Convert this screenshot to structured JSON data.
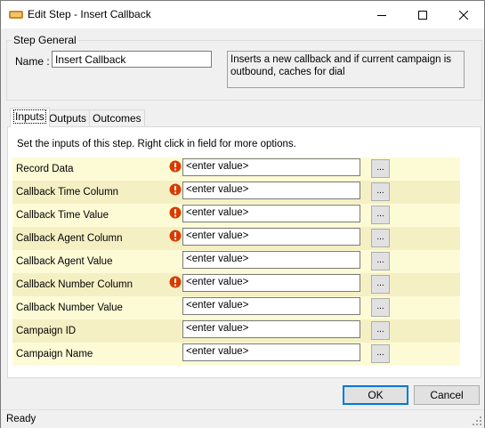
{
  "window": {
    "title": "Edit Step - Insert Callback",
    "controls": [
      "minimize",
      "maximize",
      "close"
    ]
  },
  "step_general": {
    "legend": "Step General",
    "name_label": "Name :",
    "name_value": "Insert Callback",
    "description": "Inserts a new callback and if current campaign is outbound, caches for dial"
  },
  "tabs": [
    {
      "label": "Inputs",
      "selected": true
    },
    {
      "label": "Outputs",
      "selected": false
    },
    {
      "label": "Outcomes",
      "selected": false
    }
  ],
  "inputs": {
    "instructions": "Set the inputs of this step.  Right click in field for more options.",
    "browse_label": "...",
    "rows": [
      {
        "label": "Record Data",
        "value": "<enter value>",
        "required": true
      },
      {
        "label": "Callback Time Column",
        "value": "<enter value>",
        "required": true
      },
      {
        "label": "Callback Time Value",
        "value": "<enter value>",
        "required": true
      },
      {
        "label": "Callback Agent Column",
        "value": "<enter value>",
        "required": true
      },
      {
        "label": "Callback Agent Value",
        "value": "<enter value>",
        "required": false
      },
      {
        "label": "Callback Number Column",
        "value": "<enter value>",
        "required": true
      },
      {
        "label": "Callback Number Value",
        "value": "<enter value>",
        "required": false
      },
      {
        "label": "Campaign ID",
        "value": "<enter value>",
        "required": false
      },
      {
        "label": "Campaign Name",
        "value": "<enter value>",
        "required": false
      }
    ]
  },
  "footer": {
    "ok_label": "OK",
    "cancel_label": "Cancel"
  },
  "status": {
    "text": "Ready"
  },
  "colors": {
    "row_light": "#fdfbd6",
    "row_dark": "#f5f0c4",
    "warning": "#d83b01",
    "default_button_border": "#0078d7"
  }
}
